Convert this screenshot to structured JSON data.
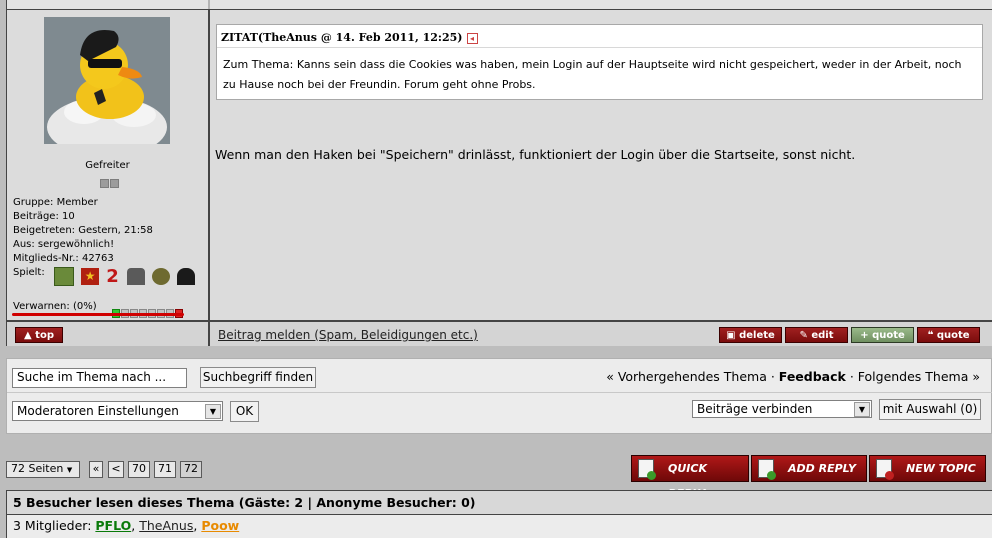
{
  "profile": {
    "rank_title": "Gefreiter",
    "group": "Gruppe: Member",
    "posts": "Beiträge: 10",
    "joined": "Beigetreten: Gestern, 21:58",
    "from": "Aus: sergewöhnlich!",
    "member_no": "Mitglieds-Nr.: 42763",
    "plays_label": "Spielt:",
    "warn_label": "Verwarnen: (0%)"
  },
  "post": {
    "quote_header": "ZITAT(TheAnus @ 14. Feb 2011, 12:25)",
    "quote_text": "Zum Thema: Kanns sein dass die Cookies was haben, mein Login auf der Hauptseite wird nicht gespeichert, weder in der Arbeit, noch zu Hause noch bei der Freundin. Forum geht ohne Probs.",
    "body": "Wenn man den Haken bei \"Speichern\" drinlässt, funktioniert der Login über die Startseite, sonst nicht."
  },
  "post_footer": {
    "top_label": "top",
    "report_link": "Beitrag melden (Spam, Beleidigungen etc.)",
    "delete_label": "delete",
    "edit_label": "edit",
    "quote_multi_label": "quote",
    "quote_label": "quote"
  },
  "mod_panel": {
    "search_value": "Suche im Thema nach ...",
    "search_button": "Suchbegriff finden",
    "nav_prev": "« Vorhergehendes Thema",
    "nav_sep1": " · ",
    "nav_forum": "Feedback",
    "nav_sep2": " · ",
    "nav_next": "Folgendes Thema »",
    "mod_select": "Moderatoren Einstellungen",
    "ok_button": "OK",
    "merge_select": "Beiträge verbinden",
    "with_selection_button": "mit Auswahl (0)"
  },
  "pagination": {
    "pages_label": "72 Seiten",
    "first": "«",
    "prev": "<",
    "pages": [
      "70",
      "71",
      "72"
    ]
  },
  "actions": {
    "quick_reply": "QUICK REPLY",
    "add_reply": "ADD REPLY",
    "new_topic": "NEW TOPIC"
  },
  "visitors": {
    "header": "5 Besucher lesen dieses Thema (Gäste: 2 | Anonyme Besucher: 0)",
    "members_prefix": "3 Mitglieder: ",
    "members": [
      "PFLO",
      "TheAnus",
      "Poow"
    ],
    "sep": ", "
  }
}
